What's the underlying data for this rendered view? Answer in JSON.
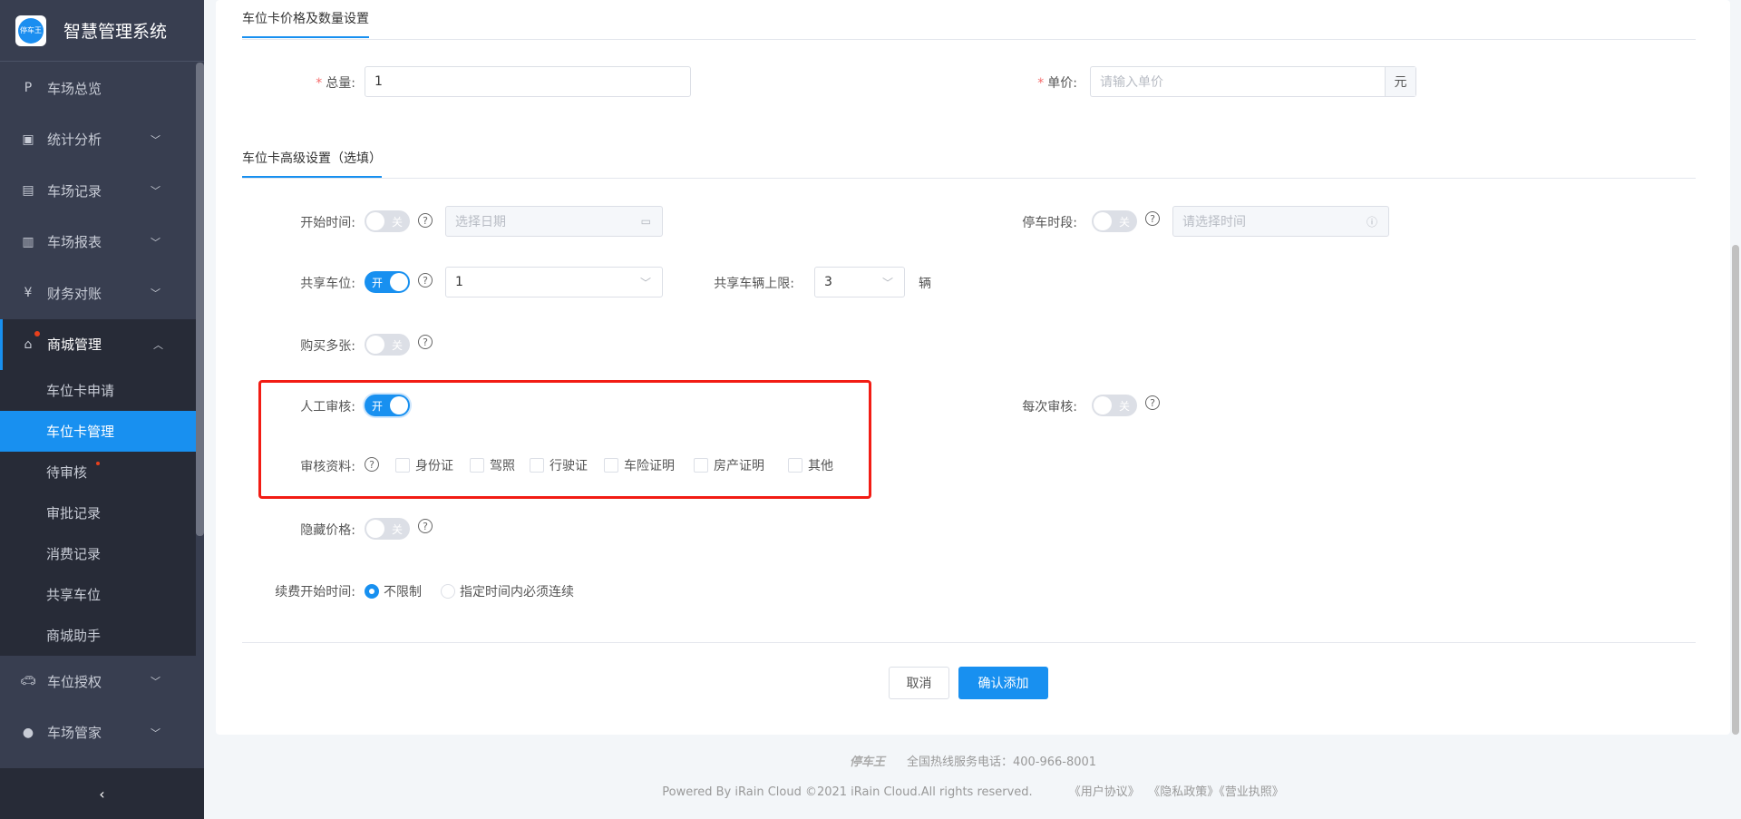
{
  "app": {
    "logo_text": "停车王",
    "title": "智慧管理系统"
  },
  "sidebar": {
    "items": [
      {
        "label": "车场总览",
        "icon": "parking-icon"
      },
      {
        "label": "统计分析",
        "icon": "monitor-chart-icon"
      },
      {
        "label": "车场记录",
        "icon": "document-icon"
      },
      {
        "label": "车场报表",
        "icon": "report-icon"
      },
      {
        "label": "财务对账",
        "icon": "yen-icon"
      },
      {
        "label": "商城管理",
        "icon": "shop-icon"
      }
    ],
    "sub_items": [
      "车位卡申请",
      "车位卡管理",
      "待审核",
      "审批记录",
      "消费记录",
      "共享车位",
      "商城助手"
    ],
    "bottom_items": [
      {
        "label": "车位授权",
        "icon": "car-icon"
      },
      {
        "label": "车场管家",
        "icon": "user-icon"
      }
    ],
    "collapse": "‹"
  },
  "form": {
    "section1": "车位卡价格及数量设置",
    "total_label": "总量:",
    "total_value": "1",
    "price_label": "单价:",
    "price_placeholder": "请输入单价",
    "price_suffix": "元",
    "section2": "车位卡高级设置（选填）",
    "start_time_label": "开始时间:",
    "start_time_switch": "关",
    "start_time_placeholder": "选择日期",
    "parking_period_label": "停车时段:",
    "parking_period_switch": "关",
    "parking_period_placeholder": "请选择时间",
    "share_label": "共享车位:",
    "share_switch": "开",
    "share_value": "1",
    "share_limit_label": "共享车辆上限:",
    "share_limit_value": "3",
    "share_limit_unit": "辆",
    "multi_label": "购买多张:",
    "multi_switch": "关",
    "manual_label": "人工审核:",
    "manual_switch": "开",
    "each_label": "每次审核:",
    "each_switch": "关",
    "docs_label": "审核资料:",
    "docs": [
      "身份证",
      "驾照",
      "行驶证",
      "车险证明",
      "房产证明",
      "其他"
    ],
    "hide_label": "隐藏价格:",
    "hide_switch": "关",
    "renew_label": "续费开始时间:",
    "renew_options": [
      "不限制",
      "指定时间内必须连续"
    ],
    "cancel": "取消",
    "confirm": "确认添加"
  },
  "footer": {
    "brand": "停车王",
    "hotline": "全国热线服务电话：400-966-8001",
    "copyright": "Powered By iRain Cloud ©2021 iRain Cloud.All rights reserved.",
    "links": [
      "《用户协议》",
      "《隐私政策》",
      "《营业执照》"
    ]
  },
  "colors": {
    "accent": "#1890f0",
    "sidebar": "#383e50",
    "highlight": "#f21c14"
  }
}
